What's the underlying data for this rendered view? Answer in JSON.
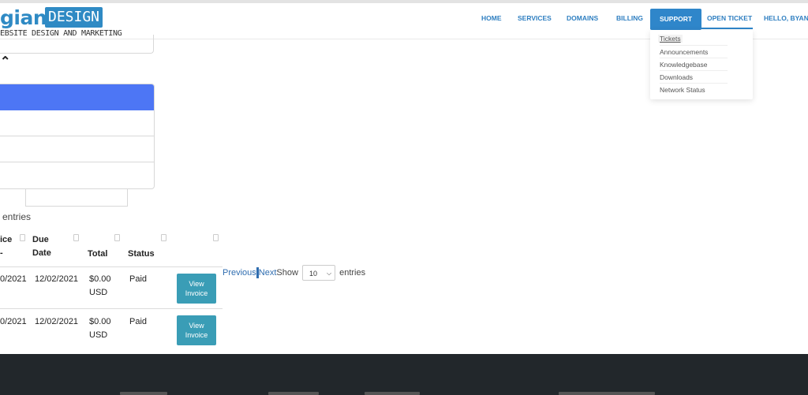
{
  "logo": {
    "word": "giant",
    "box": "DESIGN",
    "tagline": "EBSITE DESIGN AND MARKETING"
  },
  "nav": {
    "home": "HOME",
    "services": "SERVICES",
    "domains": "DOMAINS",
    "billing": "BILLING",
    "support": "SUPPORT",
    "open_ticket": "OPEN TICKET",
    "hello": "HELLO, BYANKA"
  },
  "support_menu": [
    "Tickets",
    "Announcements",
    "Knowledgebase",
    "Downloads",
    "Network Status"
  ],
  "entries_label": "entries",
  "table": {
    "headers": [
      "ice",
      "Due Date",
      "Total",
      "Status"
    ],
    "rows": [
      {
        "invoice_date": "0/2021",
        "due_date": "12/02/2021",
        "total": "$0.00 USD",
        "status": "Paid",
        "action": "View Invoice"
      },
      {
        "invoice_date": "0/2021",
        "due_date": "12/02/2021",
        "total": "$0.00 USD",
        "status": "Paid",
        "action": "View Invoice"
      }
    ]
  },
  "pagination": {
    "previous": "Previous",
    "next": "Next",
    "show": "Show",
    "page_size": "10",
    "entries": "entries"
  },
  "colors": {
    "primary": "#2f86ca",
    "active_row": "#4d76f5",
    "button": "#3a9db6",
    "footer": "#22272b"
  }
}
